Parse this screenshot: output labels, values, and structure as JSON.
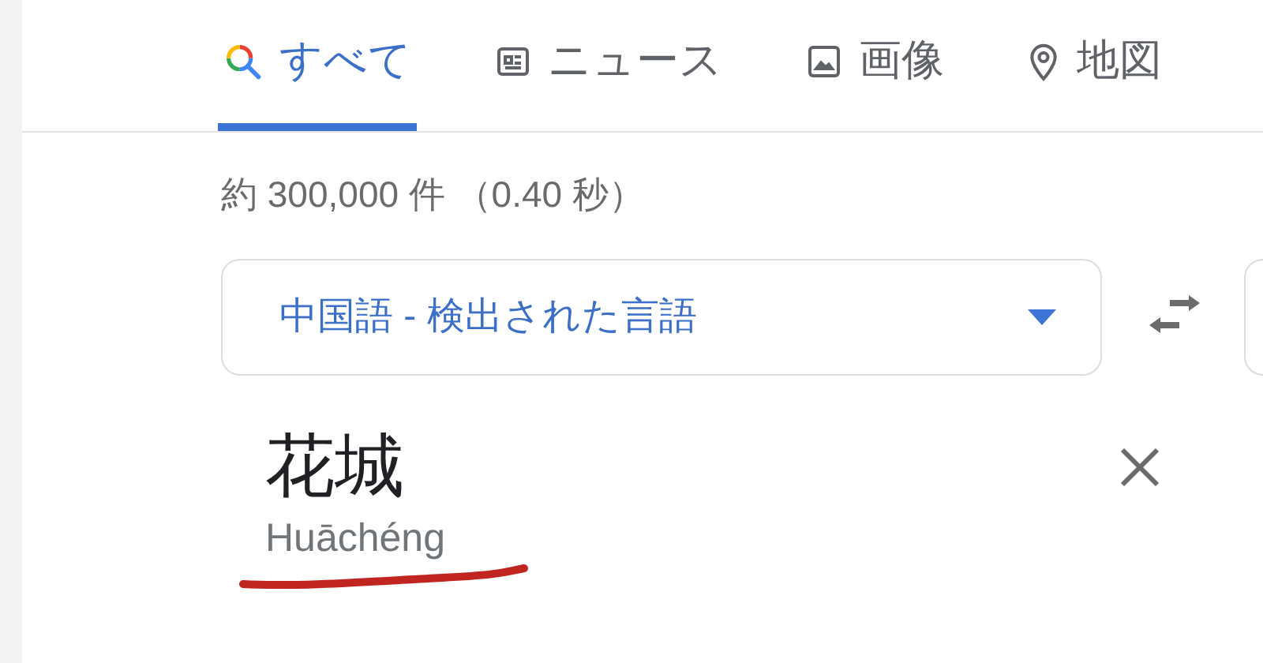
{
  "tabs": [
    {
      "kind": "all",
      "label": "すべて",
      "selected": true
    },
    {
      "kind": "news",
      "label": "ニュース",
      "selected": false
    },
    {
      "kind": "images",
      "label": "画像",
      "selected": false
    },
    {
      "kind": "maps",
      "label": "地図",
      "selected": false
    }
  ],
  "result_stats": "約 300,000 件 （0.40 秒）",
  "translator": {
    "source_language": "中国語 - 検出された言語",
    "source_text": "花城",
    "romanization": "Huāchéng",
    "underlined": true
  }
}
